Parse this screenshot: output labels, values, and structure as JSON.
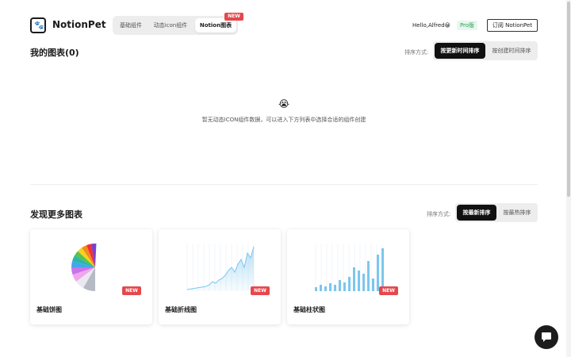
{
  "header": {
    "logo_text": "NotionPet",
    "tabs": [
      {
        "label": "基础组件"
      },
      {
        "label": "动态icon组件"
      },
      {
        "label": "Notion图表"
      }
    ],
    "tab_badge": "NEW",
    "greeting": "Hello,Alfred😀",
    "plan_badge": "Pro版",
    "subscribe_label": "订阅 NotionPet"
  },
  "my_charts": {
    "title": "我的图表(0)",
    "sort_label": "排序方式:",
    "sort_options": [
      "按更新时间排序",
      "按创建时间排序"
    ],
    "empty_emoji": "😭",
    "empty_text": "暂无动态ICON组件数据，可以进入下方列表中选择合适的组件创建"
  },
  "discover": {
    "title": "发现更多图表",
    "sort_label": "排序方式:",
    "sort_options": [
      "按最新排序",
      "按最热排序"
    ],
    "cards": [
      {
        "title": "基础饼图",
        "badge": "NEW",
        "preview": "pie"
      },
      {
        "title": "基础折线图",
        "badge": "NEW",
        "preview": "line"
      },
      {
        "title": "基础柱状图",
        "badge": "NEW",
        "preview": "bar"
      }
    ]
  },
  "colors": {
    "accent_dark": "#111111",
    "new_badge": "#e5484d",
    "pro_badge_text": "#2ea05a",
    "chart_blue": "#7cc6ee"
  },
  "icons": [
    "paw-logo-icon",
    "chat-bubble-icon"
  ]
}
